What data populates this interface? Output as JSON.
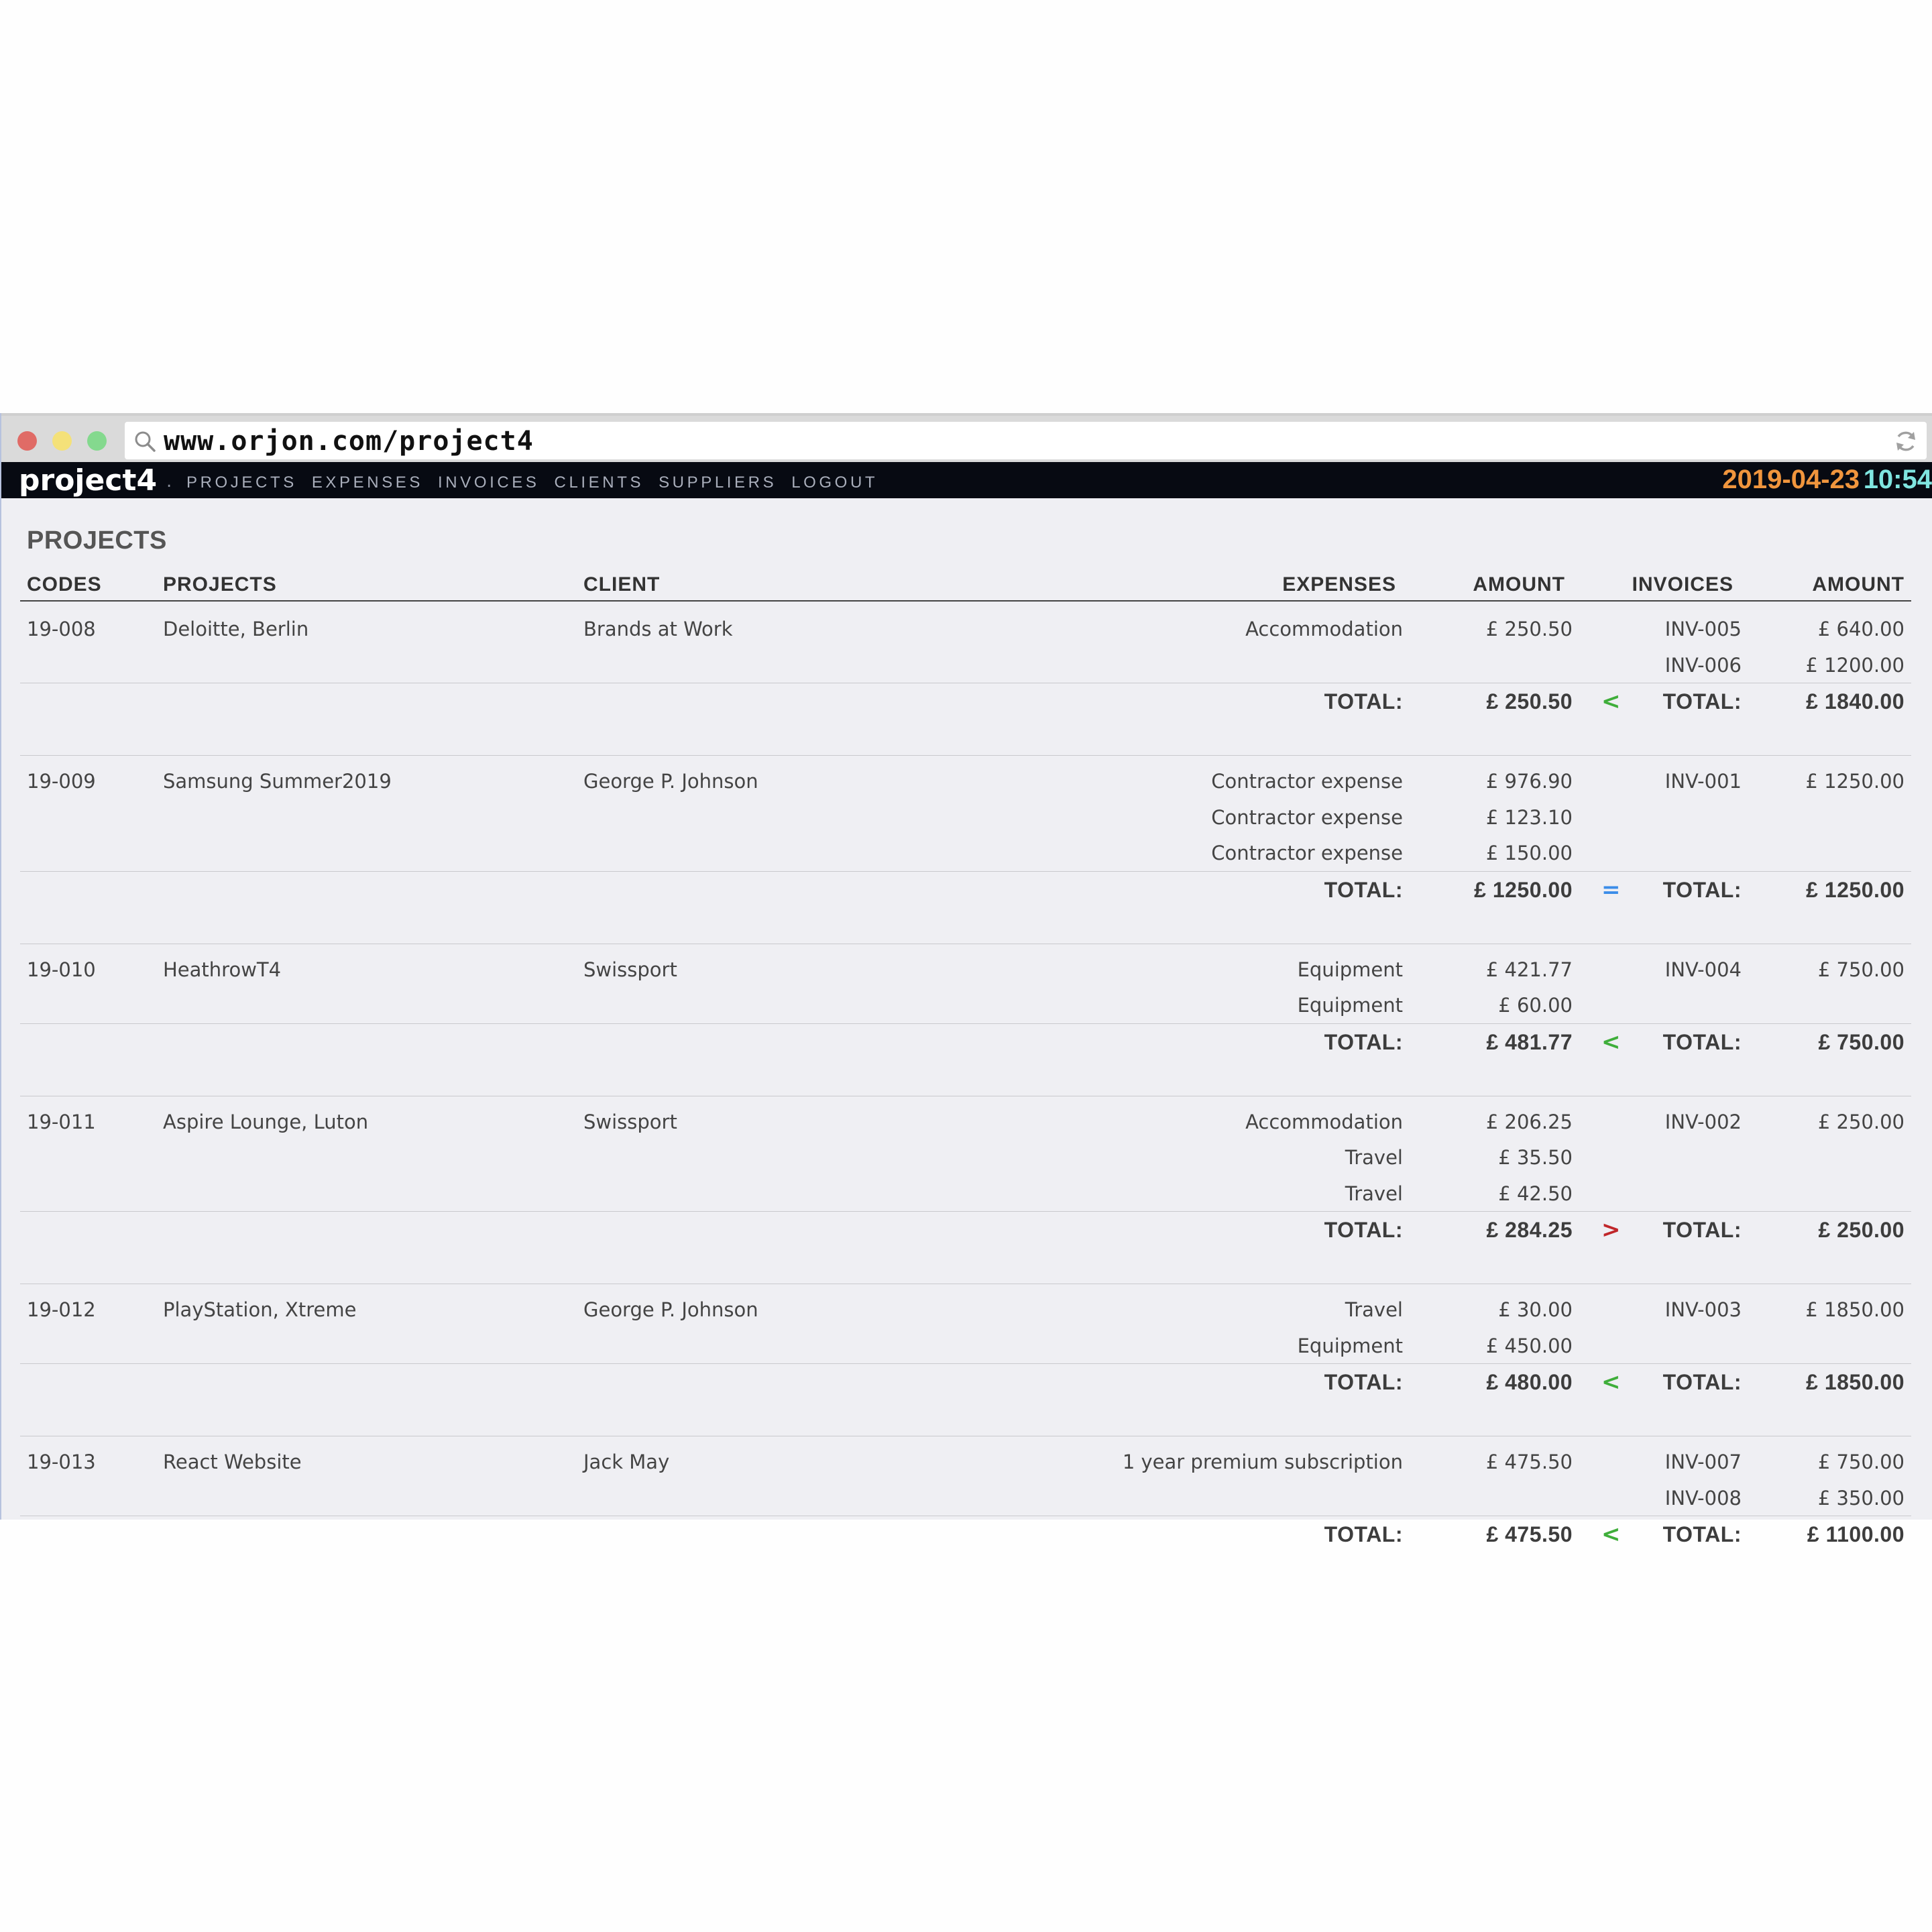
{
  "browser": {
    "url": "www.orjon.com/project4"
  },
  "app": {
    "brand": "project4",
    "brand_separator": ".",
    "nav": [
      "PROJECTS",
      "EXPENSES",
      "INVOICES",
      "CLIENTS",
      "SUPPLIERS",
      "LOGOUT"
    ],
    "date": "2019-04-23",
    "time": "10:54",
    "colors": {
      "date": "#f0953d",
      "time": "#7fe5e0",
      "less": "#3fae3a",
      "equal": "#3b8ce8",
      "greater": "#c0262a"
    }
  },
  "page": {
    "title": "PROJECTS",
    "headers": {
      "codes": "CODES",
      "projects": "PROJECTS",
      "client": "CLIENT",
      "expenses": "EXPENSES",
      "amount": "AMOUNT",
      "invoices": "INVOICES",
      "invoice_amount": "AMOUNT"
    },
    "total_label": "TOTAL:",
    "projects": [
      {
        "code": "19-008",
        "name": "Deloitte, Berlin",
        "client": "Brands at Work",
        "expenses": [
          {
            "type": "Accommodation",
            "amount": "£ 250.50"
          }
        ],
        "invoices": [
          {
            "id": "INV-005",
            "amount": "£ 640.00"
          },
          {
            "id": "INV-006",
            "amount": "£ 1200.00"
          }
        ],
        "expense_total": "£ 250.50",
        "comparison": "<",
        "comparison_status": "less",
        "invoice_total": "£ 1840.00"
      },
      {
        "code": "19-009",
        "name": "Samsung Summer2019",
        "client": "George P. Johnson",
        "expenses": [
          {
            "type": "Contractor expense",
            "amount": "£ 976.90"
          },
          {
            "type": "Contractor expense",
            "amount": "£ 123.10"
          },
          {
            "type": "Contractor expense",
            "amount": "£ 150.00"
          }
        ],
        "invoices": [
          {
            "id": "INV-001",
            "amount": "£ 1250.00"
          }
        ],
        "expense_total": "£ 1250.00",
        "comparison": "=",
        "comparison_status": "equal",
        "invoice_total": "£ 1250.00"
      },
      {
        "code": "19-010",
        "name": "HeathrowT4",
        "client": "Swissport",
        "expenses": [
          {
            "type": "Equipment",
            "amount": "£ 421.77"
          },
          {
            "type": "Equipment",
            "amount": "£ 60.00"
          }
        ],
        "invoices": [
          {
            "id": "INV-004",
            "amount": "£ 750.00"
          }
        ],
        "expense_total": "£ 481.77",
        "comparison": "<",
        "comparison_status": "less",
        "invoice_total": "£ 750.00"
      },
      {
        "code": "19-011",
        "name": "Aspire Lounge, Luton",
        "client": "Swissport",
        "expenses": [
          {
            "type": "Accommodation",
            "amount": "£ 206.25"
          },
          {
            "type": "Travel",
            "amount": "£ 35.50"
          },
          {
            "type": "Travel",
            "amount": "£ 42.50"
          }
        ],
        "invoices": [
          {
            "id": "INV-002",
            "amount": "£ 250.00"
          }
        ],
        "expense_total": "£ 284.25",
        "comparison": ">",
        "comparison_status": "greater",
        "invoice_total": "£ 250.00"
      },
      {
        "code": "19-012",
        "name": "PlayStation, Xtreme",
        "client": "George P. Johnson",
        "expenses": [
          {
            "type": "Travel",
            "amount": "£ 30.00"
          },
          {
            "type": "Equipment",
            "amount": "£ 450.00"
          }
        ],
        "invoices": [
          {
            "id": "INV-003",
            "amount": "£ 1850.00"
          }
        ],
        "expense_total": "£ 480.00",
        "comparison": "<",
        "comparison_status": "less",
        "invoice_total": "£ 1850.00"
      },
      {
        "code": "19-013",
        "name": "React Website",
        "client": "Jack May",
        "expenses": [
          {
            "type": "1 year premium subscription",
            "amount": "£ 475.50"
          }
        ],
        "invoices": [
          {
            "id": "INV-007",
            "amount": "£ 750.00"
          },
          {
            "id": "INV-008",
            "amount": "£ 350.00"
          }
        ],
        "expense_total": "£ 475.50",
        "comparison": "<",
        "comparison_status": "less",
        "invoice_total": "£ 1100.00"
      }
    ]
  }
}
